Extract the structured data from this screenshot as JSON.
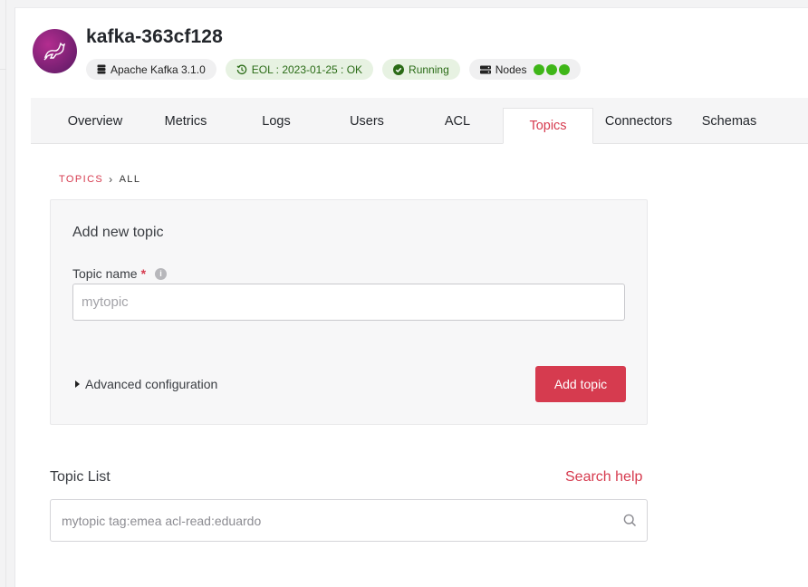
{
  "service": {
    "name": "kafka-363cf128",
    "version_badge": "Apache Kafka 3.1.0",
    "eol_badge": "EOL : 2023-01-25 : OK",
    "status_badge": "Running",
    "nodes_label": "Nodes",
    "node_count": 3
  },
  "tabs": [
    {
      "label": "Overview"
    },
    {
      "label": "Metrics"
    },
    {
      "label": "Logs"
    },
    {
      "label": "Users"
    },
    {
      "label": "ACL"
    },
    {
      "label": "Topics",
      "active": true
    },
    {
      "label": "Connectors"
    },
    {
      "label": "Schemas"
    }
  ],
  "breadcrumb": {
    "parent": "TOPICS",
    "current": "ALL"
  },
  "add_topic": {
    "title": "Add new topic",
    "field_label": "Topic name",
    "required_mark": "*",
    "placeholder": "mytopic",
    "advanced_label": "Advanced configuration",
    "submit_label": "Add topic"
  },
  "topic_list": {
    "title": "Topic List",
    "help_link": "Search help",
    "search_placeholder": "mytopic tag:emea acl-read:eduardo"
  },
  "colors": {
    "accent": "#d63b4f",
    "success": "#3fb618"
  }
}
